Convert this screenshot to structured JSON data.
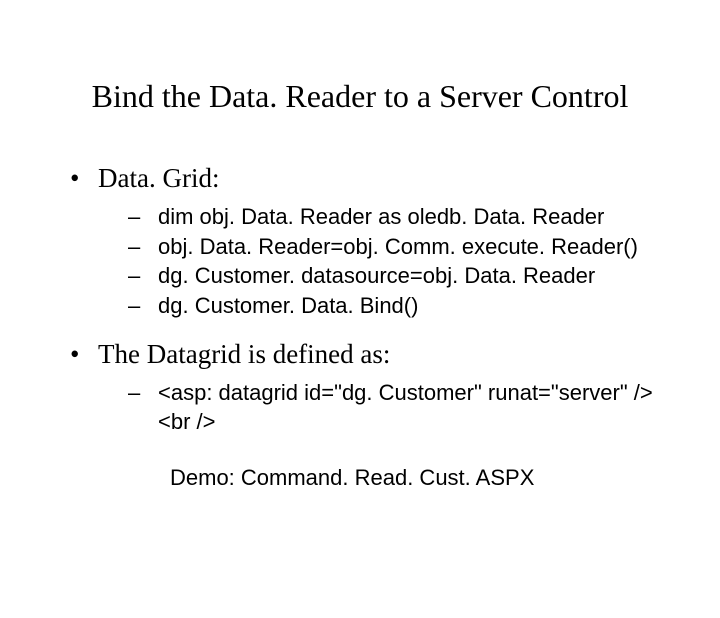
{
  "title": "Bind the Data. Reader to a Server Control",
  "bullets": [
    {
      "label": "Data. Grid:",
      "sub": [
        "dim obj. Data. Reader as oledb. Data. Reader",
        "obj. Data. Reader=obj. Comm. execute. Reader()",
        "dg. Customer. datasource=obj. Data. Reader",
        "dg. Customer. Data. Bind()"
      ]
    },
    {
      "label": "The Datagrid is defined as:",
      "sub": [
        "<asp: datagrid id=\"dg. Customer\" runat=\"server\" /><br />"
      ]
    }
  ],
  "demo": "Demo: Command. Read. Cust. ASPX"
}
